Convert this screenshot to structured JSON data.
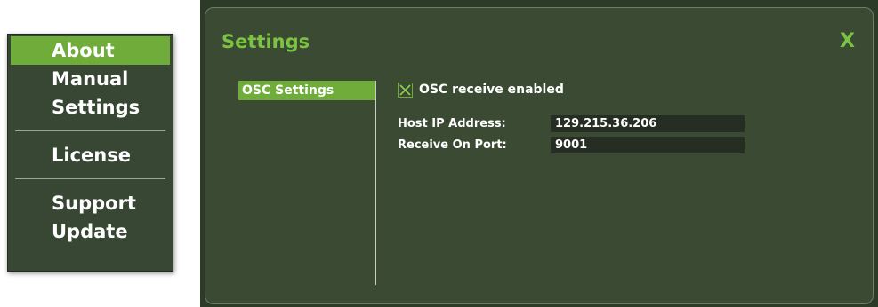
{
  "menu": {
    "items": [
      {
        "label": "About"
      },
      {
        "label": "Manual"
      },
      {
        "label": "Settings"
      },
      {
        "label": "License"
      },
      {
        "label": "Support"
      },
      {
        "label": "Update"
      }
    ]
  },
  "dialog": {
    "title": "Settings",
    "close_label": "X",
    "nav": {
      "items": [
        {
          "label": "OSC Settings"
        }
      ]
    },
    "osc": {
      "receive_enabled_label": "OSC receive enabled",
      "receive_enabled": true,
      "host_ip_label": "Host IP Address:",
      "host_ip_value": "129.215.36.206",
      "port_label": "Receive On Port:",
      "port_value": "9001"
    }
  },
  "colors": {
    "accent": "#6fac3a",
    "title_green": "#7cc243",
    "panel_bg": "#3a4a33",
    "input_bg": "#262e23"
  }
}
